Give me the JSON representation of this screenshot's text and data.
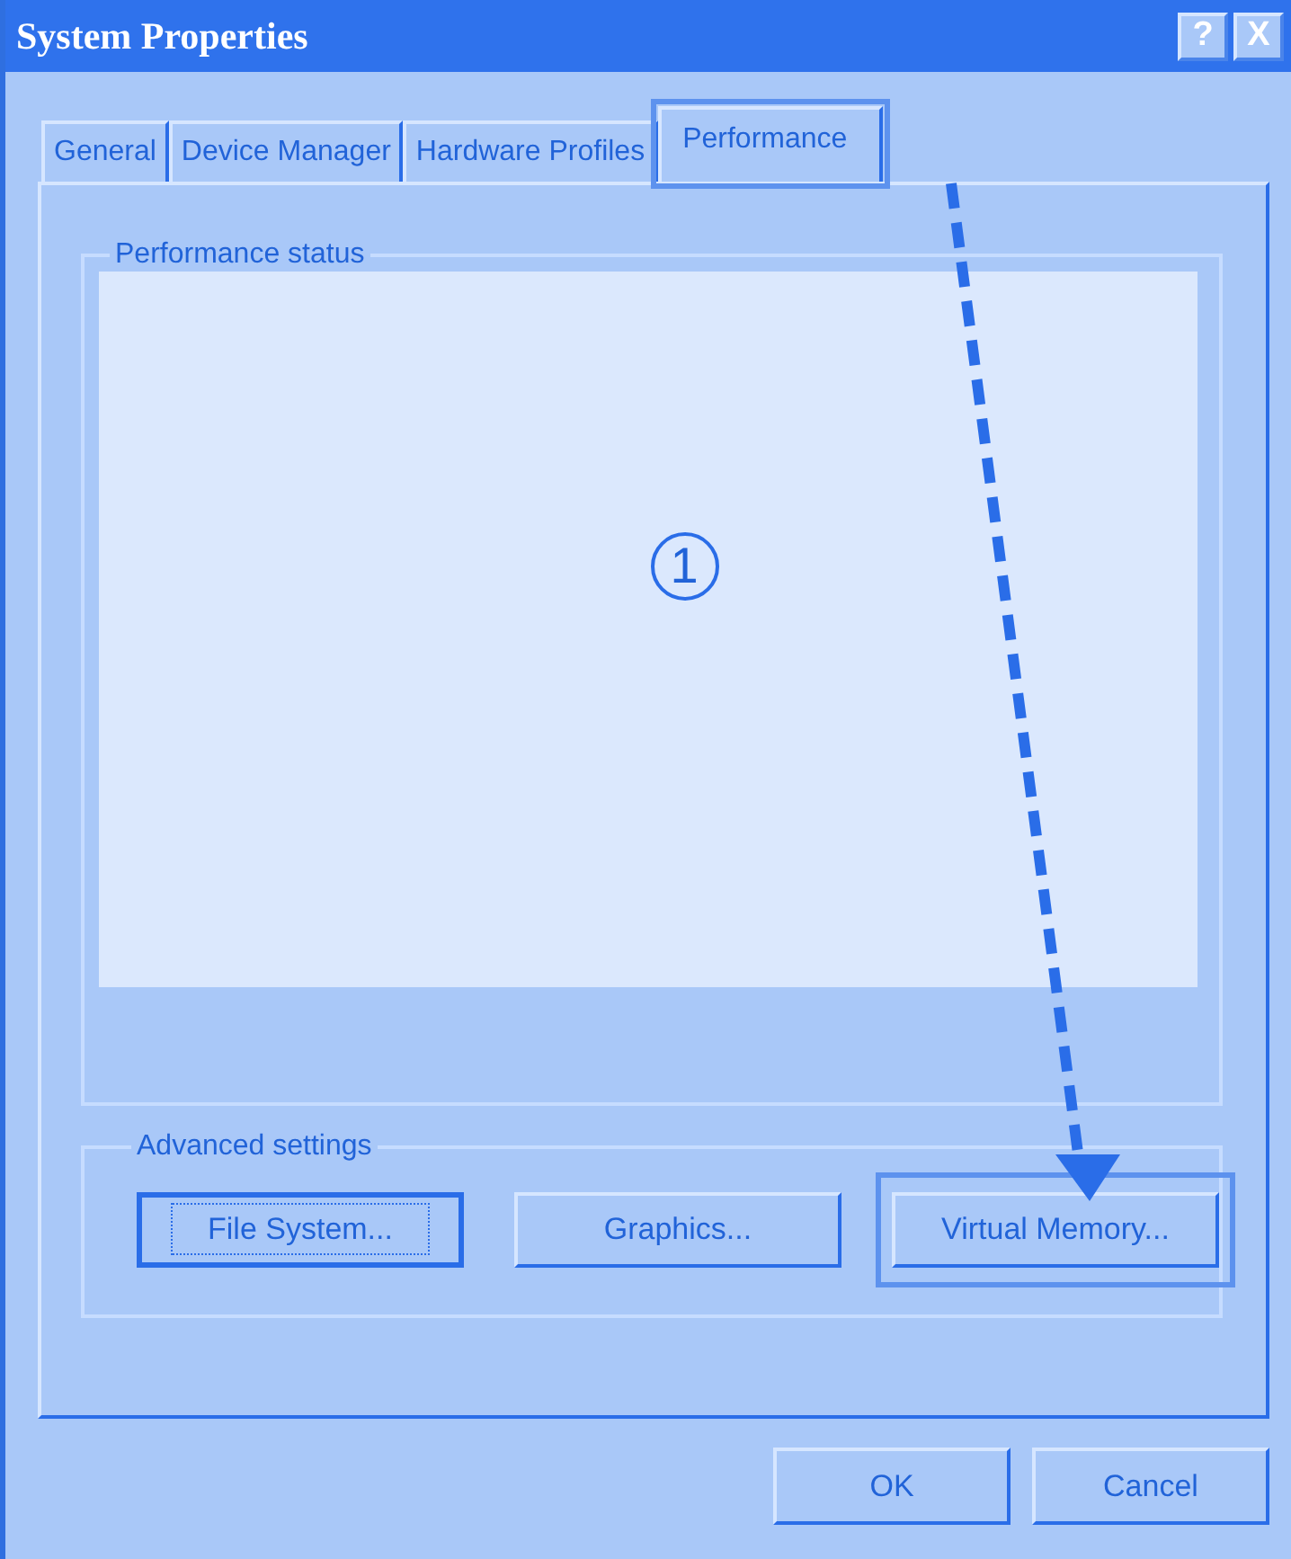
{
  "window": {
    "title": "System Properties",
    "controls": [
      "?",
      "X"
    ]
  },
  "tabs": [
    {
      "label": "General",
      "selected": false,
      "highlighted": false
    },
    {
      "label": "Device Manager",
      "selected": false,
      "highlighted": false
    },
    {
      "label": "Hardware Profiles",
      "selected": false,
      "highlighted": false
    },
    {
      "label": "Performance",
      "selected": true,
      "highlighted": true
    }
  ],
  "performance_status": {
    "label": "Performance status",
    "step_marker": "1"
  },
  "advanced_settings": {
    "label": "Advanced settings",
    "buttons": [
      {
        "label": "File System...",
        "focused": true,
        "highlighted": false
      },
      {
        "label": "Graphics...",
        "focused": false,
        "highlighted": false
      },
      {
        "label": "Virtual Memory...",
        "focused": false,
        "highlighted": true
      }
    ]
  },
  "annotation": {
    "arrow": true
  },
  "buttons": [
    "OK",
    "Cancel"
  ]
}
